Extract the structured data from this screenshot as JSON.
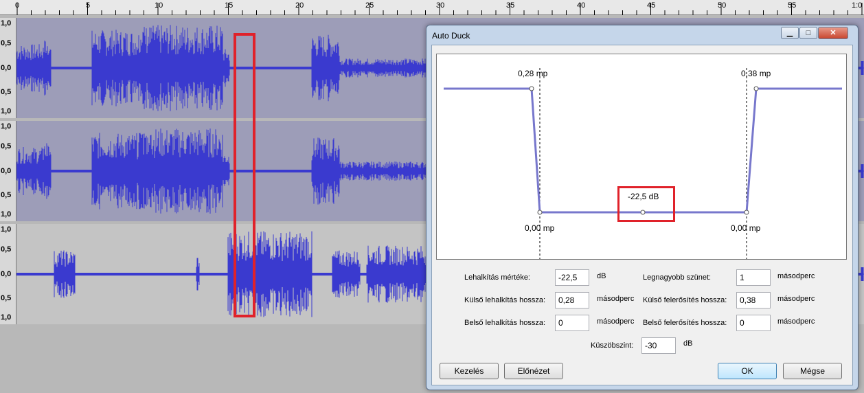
{
  "ruler": {
    "ticks": [
      "0",
      "5",
      "10",
      "15",
      "20",
      "25",
      "30",
      "35",
      "40",
      "45",
      "50",
      "55",
      "1:0"
    ]
  },
  "tracks": [
    {
      "scale": [
        "1,0",
        "0,5",
        "0,0",
        "0,5",
        "1,0"
      ]
    },
    {
      "scale": [
        "1,0",
        "0,5",
        "0,0",
        "0,5",
        "1,0"
      ]
    },
    {
      "scale": [
        "1,0",
        "0,5",
        "0,0",
        "0,5",
        "1,0"
      ]
    }
  ],
  "dialog": {
    "title": "Auto Duck",
    "window_buttons": {
      "minimize": "▁",
      "maximize": "□",
      "close": "✕"
    },
    "graph": {
      "label_top_left": "0,28 mp",
      "label_top_right": "0,38 mp",
      "label_bottom_left": "0,00 mp",
      "label_bottom_right": "0,00 mp",
      "label_center": "-22,5 dB"
    },
    "fields": {
      "duck_amount": {
        "label": "Lehalkítás mértéke:",
        "value": "-22,5",
        "unit": "dB"
      },
      "max_pause": {
        "label": "Legnagyobb szünet:",
        "value": "1",
        "unit": "másodperc"
      },
      "outer_fade_down": {
        "label": "Külső lehalkítás hossza:",
        "value": "0,28",
        "unit": "másodperc"
      },
      "outer_fade_up": {
        "label": "Külső felerősítés hossza:",
        "value": "0,38",
        "unit": "másodperc"
      },
      "inner_fade_down": {
        "label": "Belső lehalkítás hossza:",
        "value": "0",
        "unit": "másodperc"
      },
      "inner_fade_up": {
        "label": "Belső felerősítés hossza:",
        "value": "0",
        "unit": "másodperc"
      },
      "threshold": {
        "label": "Küszöbszint:",
        "value": "-30",
        "unit": "dB"
      }
    },
    "buttons": {
      "manage": "Kezelés",
      "preview": "Előnézet",
      "ok": "OK",
      "cancel": "Mégse"
    }
  },
  "colors": {
    "wave": "#3a3acf",
    "track_bg_upper": "#9d9db8",
    "track_bg_lower": "#c4c4c4",
    "highlight_box": "#e0222a",
    "envelope": "#7777cc"
  }
}
